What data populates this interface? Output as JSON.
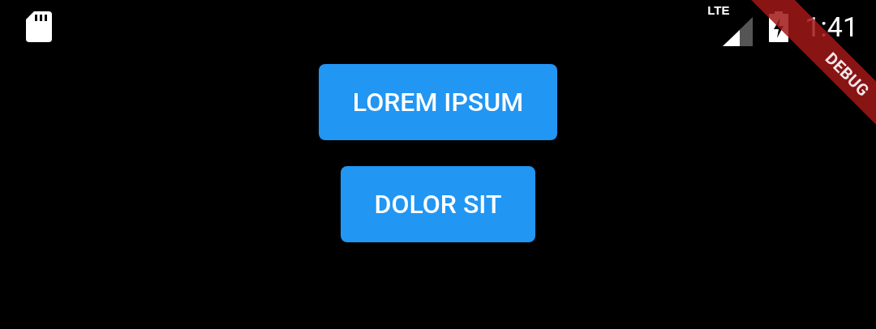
{
  "status_bar": {
    "network": "LTE",
    "time": "1:41"
  },
  "buttons": [
    {
      "label": "LOREM IPSUM"
    },
    {
      "label": "DOLOR SIT"
    }
  ],
  "debug_banner": {
    "label": "DEBUG"
  }
}
